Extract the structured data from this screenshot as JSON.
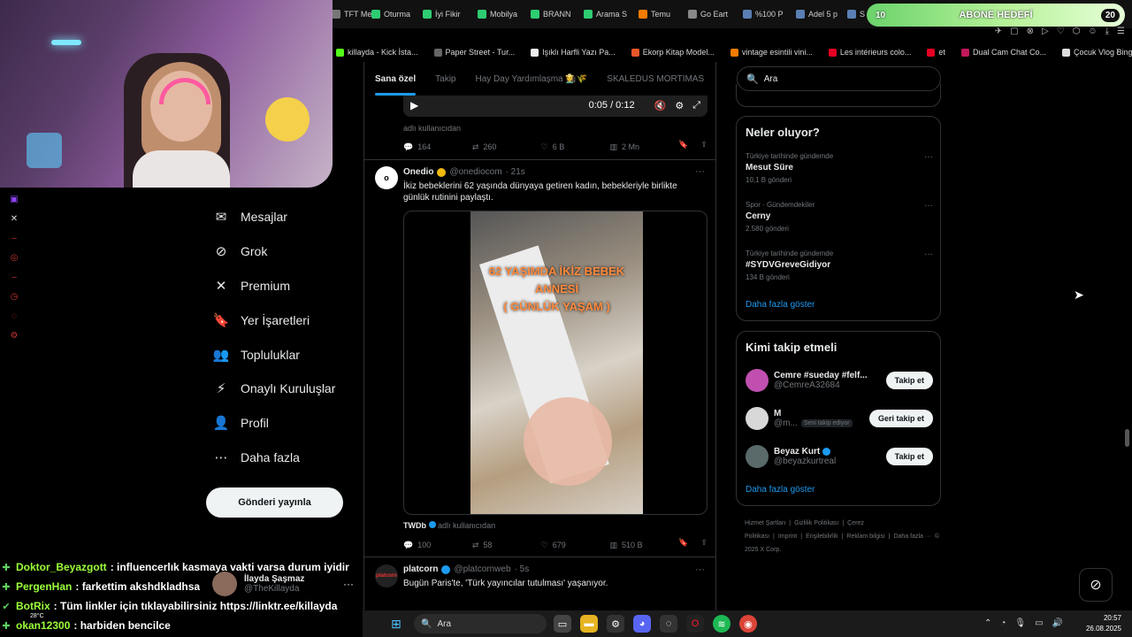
{
  "browser": {
    "tabs": [
      {
        "label": "TFT Me",
        "color": "#777"
      },
      {
        "label": "Oturma",
        "color": "#2ecc71"
      },
      {
        "label": "İyi Fikir",
        "color": "#2ecc71"
      },
      {
        "label": "Mobilya",
        "color": "#2ecc71"
      },
      {
        "label": "BRANN",
        "color": "#2ecc71"
      },
      {
        "label": "Arama S",
        "color": "#2ecc71"
      },
      {
        "label": "Temu",
        "color": "#f57c00"
      },
      {
        "label": "Go Eart",
        "color": "#888"
      },
      {
        "label": "%100 P",
        "color": "#5a7fb5"
      },
      {
        "label": "Adel 5 p",
        "color": "#5a7fb5"
      },
      {
        "label": "S",
        "color": "#5a7fb5"
      }
    ],
    "bookmarks": [
      {
        "label": "killayda - Kick İsta...",
        "color": "#53fc18"
      },
      {
        "label": "Paper Street - Tur...",
        "color": "#666"
      },
      {
        "label": "Işıklı Harfli Yazı Pa...",
        "color": "#eee"
      },
      {
        "label": "Ekorp Kitap Model...",
        "color": "#e8572a"
      },
      {
        "label": "vintage esintili vini...",
        "color": "#f57c00"
      },
      {
        "label": "Les intérieurs colo...",
        "color": "#e60023"
      },
      {
        "label": "et",
        "color": "#e60023"
      },
      {
        "label": "Dual Cam Chat Co...",
        "color": "#c2185b"
      },
      {
        "label": "Çocuk Vlog Bingosu",
        "color": "#ddd"
      }
    ],
    "bookmarks_more": "›"
  },
  "goal": {
    "left_value": "10",
    "label": "ABONE HEDEFİ",
    "right_value": "20"
  },
  "nav": {
    "items": [
      {
        "label": "Mesajlar",
        "icon": "mail-icon"
      },
      {
        "label": "Grok",
        "icon": "grok-icon"
      },
      {
        "label": "Premium",
        "icon": "x-premium-icon"
      },
      {
        "label": "Yer İşaretleri",
        "icon": "bookmark-icon"
      },
      {
        "label": "Topluluklar",
        "icon": "communities-icon"
      },
      {
        "label": "Onaylı Kuruluşlar",
        "icon": "lightning-icon"
      },
      {
        "label": "Profil",
        "icon": "profile-icon"
      },
      {
        "label": "Daha fazla",
        "icon": "more-circle-icon"
      }
    ],
    "post_button": "Gönderi yayınla"
  },
  "account": {
    "name": "İlayda Şaşmaz",
    "handle": "@TheKillayda",
    "more": "···"
  },
  "chat": [
    {
      "user": "Doktor_Beyazgott",
      "msg": ": influencerlık kasmaya vakti varsa durum iyidir"
    },
    {
      "user": "PergenHan",
      "msg": ": farkettim akshdkladhsa"
    },
    {
      "user": "BotRix",
      "msg": ": Tüm linkler için tıklayabilirsiniz https://linktr.ee/killayda"
    },
    {
      "user": "okan12300",
      "msg": ": harbiden bencilce"
    }
  ],
  "feed": {
    "tabs": [
      {
        "label": "Sana özel",
        "active": true
      },
      {
        "label": "Takip",
        "active": false
      },
      {
        "label": "Hay Day Yardımlaşma 👩‍🌾🌾",
        "active": false
      },
      {
        "label": "SKALEDUS MORTIMAS",
        "active": false
      }
    ],
    "video1": {
      "time": "0:05 / 0:12"
    },
    "tweet1_footer": {
      "source": "adlı kullanıcıdan",
      "replies": "164",
      "reposts": "260",
      "likes": "6 B",
      "views": "2 Mn"
    },
    "tweet2": {
      "avatar_text": "o",
      "name": "Onedio",
      "handle": "@onediocom",
      "time": "· 21s",
      "text": "İkiz bebeklerini 62 yaşında dünyaya getiren kadın, bebekleriyle birlikte günlük rutinini paylaştı.",
      "overlay": "62 YAŞIMDA İKİZ BEBEK\nANNESİ\n( GÜNLÜK YAŞAM )",
      "source_name": "TWDb",
      "source": "adlı kullanıcıdan",
      "replies": "100",
      "reposts": "58",
      "likes": "679",
      "views": "510 B"
    },
    "tweet3": {
      "avatar_text": "platcorn",
      "name": "platcorn",
      "handle": "@platcornweb",
      "time": "· 5s",
      "text": "Bugün Paris'te, 'Türk yayıncılar tutulması' yaşanıyor."
    }
  },
  "sidebar_right": {
    "search_placeholder": "Ara",
    "trends_title": "Neler oluyor?",
    "trends": [
      {
        "context": "Türkiye tarihinde gündemde",
        "topic": "Mesut Süre",
        "count": "10,1 B gönderi"
      },
      {
        "context": "Spor · Gündemdekiler",
        "topic": "Cerny",
        "count": "2.580 gönderi"
      },
      {
        "context": "Türkiye tarihinde gündemde",
        "topic": "#SYDVGreveGidiyor",
        "count": "134 B gönderi"
      }
    ],
    "trends_more": "Daha fazla göster",
    "follow_title": "Kimi takip etmeli",
    "follow": [
      {
        "name": "Cemre #sueday #felf...",
        "handle": "@CemreA32684",
        "button": "Takip et",
        "follows_you": "",
        "verified": false,
        "avatar_color": "#c04fb0"
      },
      {
        "name": "M",
        "handle": "@m...",
        "button": "Geri takip et",
        "follows_you": "Seni takip ediyor",
        "verified": false,
        "avatar_color": "#d8d8d8"
      },
      {
        "name": "Beyaz Kurt",
        "handle": "@beyazkurtreal",
        "button": "Takip et",
        "follows_you": "",
        "verified": true,
        "avatar_color": "#5a6a6a"
      }
    ],
    "follow_more": "Daha fazla göster",
    "footer": [
      "Hizmet Şartları",
      "|",
      "Gizlilik Politikası",
      "|",
      "Çerez Politikası",
      "|",
      "Imprint",
      "|",
      "Erişilebilirlik",
      "|",
      "Reklam bilgisi",
      "|",
      "Daha fazla ···",
      "© 2025 X Corp."
    ]
  },
  "taskbar": {
    "search": "Ara",
    "weather": "28°C",
    "time": "20:57",
    "date": "26.08.2025"
  },
  "colors": {
    "accent": "#1d9bf0",
    "bg": "#000000",
    "chat_user": "#9cff3b"
  }
}
